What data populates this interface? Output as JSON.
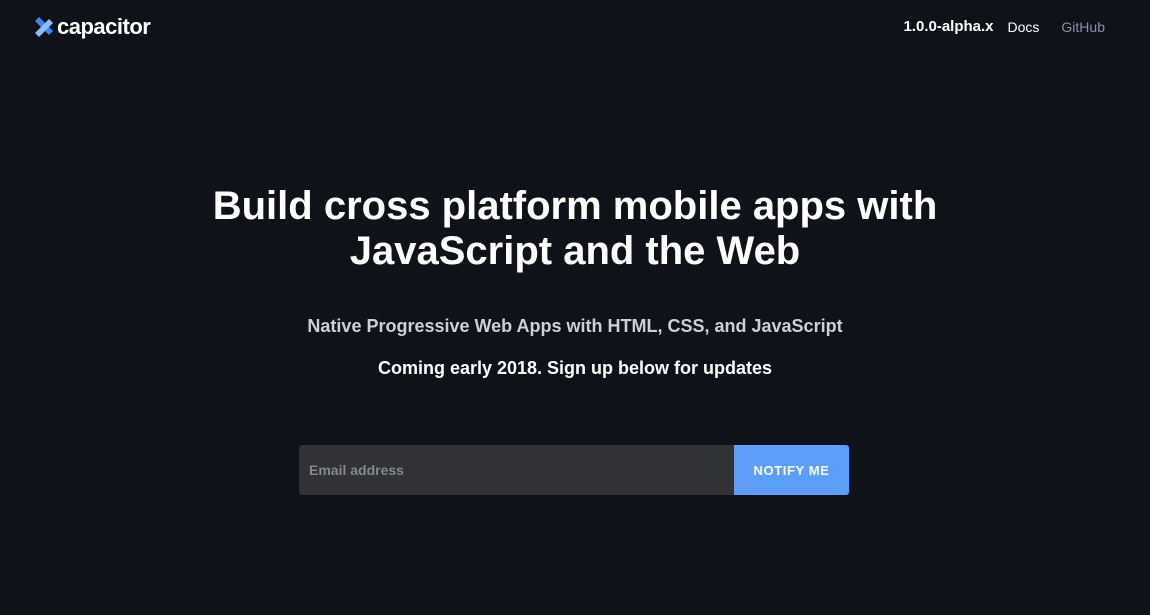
{
  "brand": {
    "name": "capacitor",
    "icon": "capacitor-logo-icon",
    "accent": "#5d9dfc"
  },
  "nav": {
    "version": "1.0.0-alpha.x",
    "docs": "Docs",
    "github": "GitHub"
  },
  "hero": {
    "title_line1": "Build cross platform mobile apps with",
    "title_line2": "JavaScript and the Web",
    "subtitle": "Native Progressive Web Apps with HTML, CSS, and JavaScript",
    "coming": "Coming early 2018. Sign up below for updates"
  },
  "signup": {
    "placeholder": "Email address",
    "value": "",
    "button": "NOTIFY ME"
  },
  "colors": {
    "background": "#10121a",
    "input_bg": "#303236",
    "button_bg": "#5d9dfc",
    "link_muted": "#8a8fa3"
  }
}
